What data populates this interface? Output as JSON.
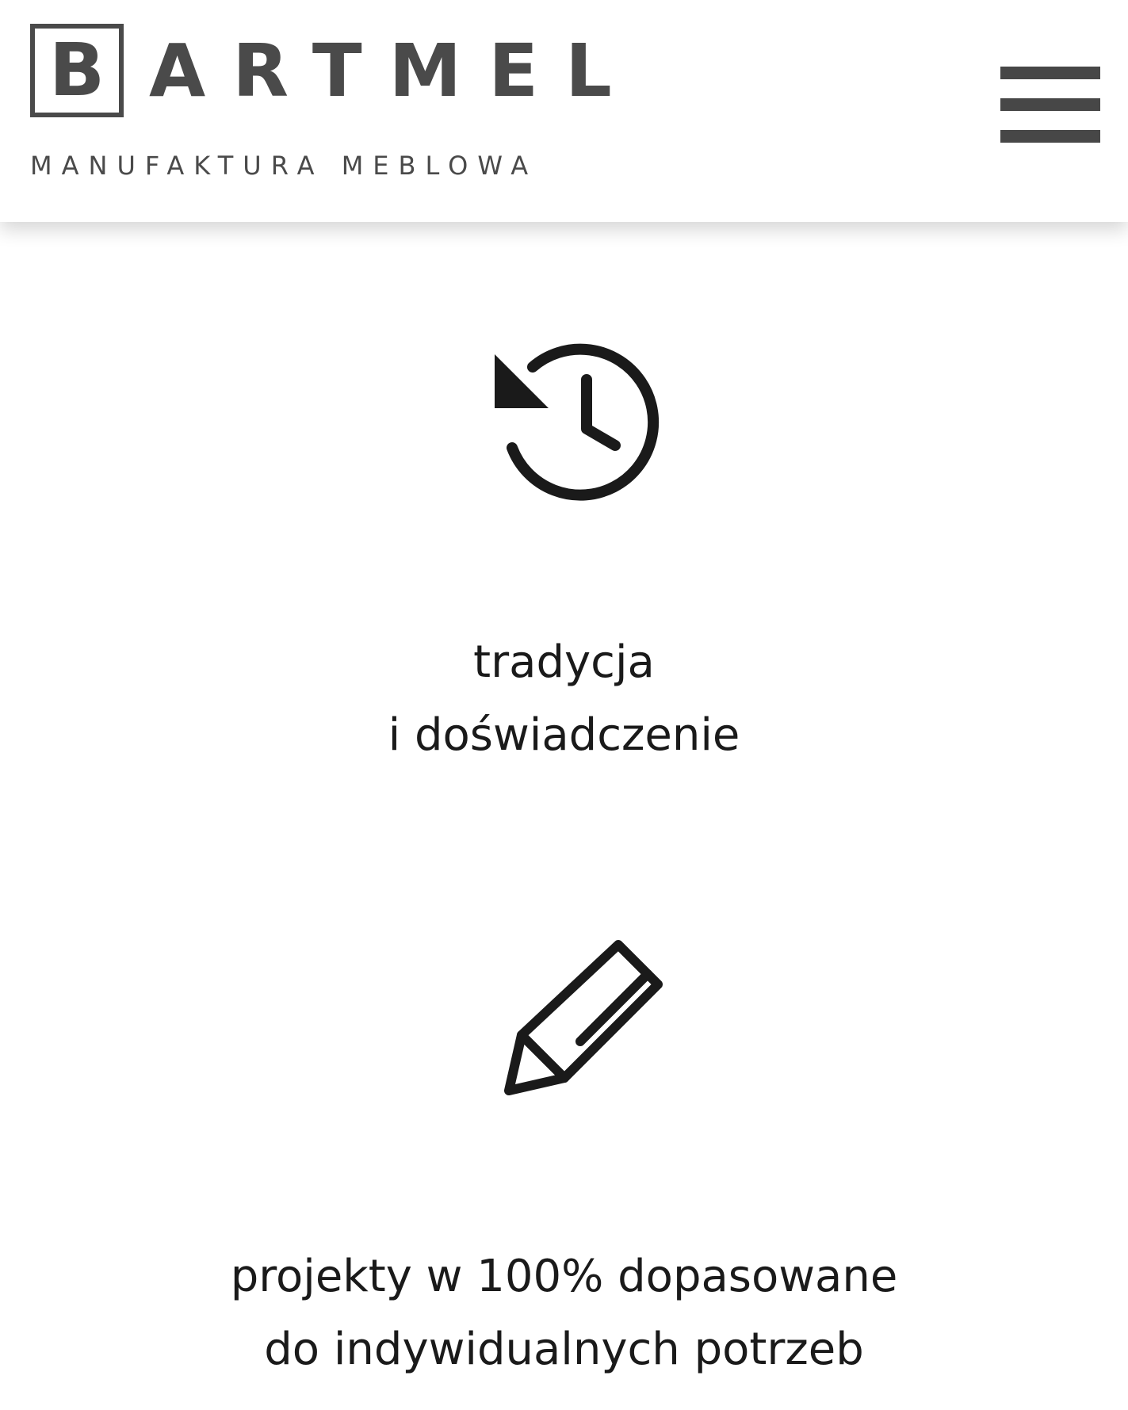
{
  "header": {
    "logo": {
      "letter": "B",
      "name_rest": "ARTMEL",
      "tagline": "MANUFAKTURA MEBLOWA"
    },
    "menu_icon": "hamburger-menu-icon"
  },
  "features": [
    {
      "icon": "history-clock-icon",
      "line1": "tradycja",
      "line2": "i doświadczenie"
    },
    {
      "icon": "pencil-icon",
      "line1": "projekty w 100% dopasowane",
      "line2": "do indywidualnych potrzeb"
    }
  ],
  "colors": {
    "logo": "#4a4a4a",
    "menu": "#474747",
    "text": "#1a1a1a",
    "icon": "#1a1a1a",
    "background": "#ffffff"
  }
}
